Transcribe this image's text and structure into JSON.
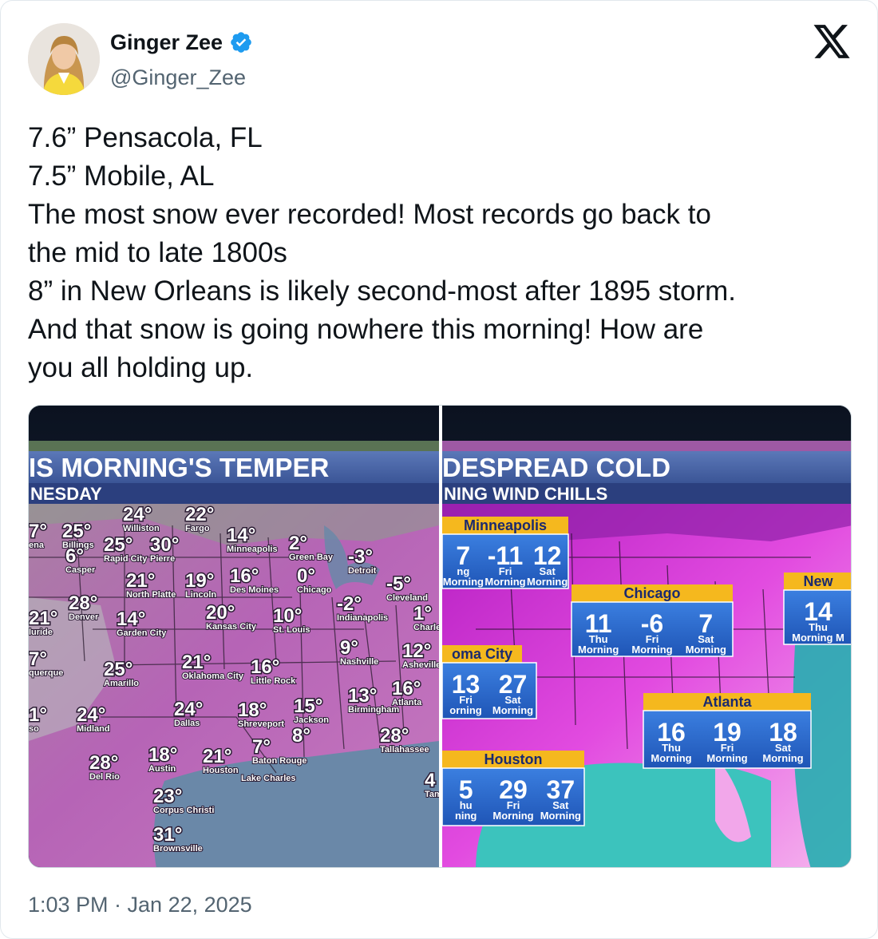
{
  "author": {
    "display_name": "Ginger Zee",
    "handle": "@Ginger_Zee",
    "verified_color": "#1d9bf0",
    "avatar_icon": "profile-photo"
  },
  "platform_icon": "x-logo-icon",
  "tweet": {
    "lines": [
      "7.6” Pensacola, FL",
      "7.5” Mobile, AL",
      "The most snow ever recorded! Most records go back to",
      "the mid to late 1800s",
      "8” in New Orleans is likely  second-most after 1895 storm.",
      "And that snow is going nowhere this morning! How are",
      "you all holding up."
    ],
    "timestamp": "1:03 PM · Jan 22, 2025"
  },
  "media": {
    "left_map": {
      "title": "IS MORNING'S TEMPER",
      "subtitle": "NESDAY",
      "readings": [
        {
          "t": "24°",
          "c": "Williston"
        },
        {
          "t": "22°",
          "c": "Fargo"
        },
        {
          "t": "7°",
          "c": "ena"
        },
        {
          "t": "25°",
          "c": "Billings"
        },
        {
          "t": "6°",
          "c": "Casper"
        },
        {
          "t": "25°",
          "c": "Rapid City"
        },
        {
          "t": "30°",
          "c": "Pierre"
        },
        {
          "t": "14°",
          "c": "Minneapolis"
        },
        {
          "t": "2°",
          "c": "Green Bay"
        },
        {
          "t": "-3°",
          "c": "Detroit"
        },
        {
          "t": "21°",
          "c": "North Platte"
        },
        {
          "t": "19°",
          "c": "Lincoln"
        },
        {
          "t": "16°",
          "c": "Des Moines"
        },
        {
          "t": "0°",
          "c": "Chicago"
        },
        {
          "t": "-5°",
          "c": "Cleveland"
        },
        {
          "t": "28°",
          "c": "Denver"
        },
        {
          "t": "-2°",
          "c": "Indianapolis"
        },
        {
          "t": "21°",
          "c": "luride"
        },
        {
          "t": "14°",
          "c": "Garden City"
        },
        {
          "t": "20°",
          "c": "Kansas City"
        },
        {
          "t": "10°",
          "c": "St. Louis"
        },
        {
          "t": "1°",
          "c": "Charleston"
        },
        {
          "t": "9°",
          "c": "Nashville"
        },
        {
          "t": "12°",
          "c": "Asheville"
        },
        {
          "t": "7°",
          "c": "querque"
        },
        {
          "t": "25°",
          "c": "Amarillo"
        },
        {
          "t": "21°",
          "c": "Oklahoma City"
        },
        {
          "t": "16°",
          "c": "Little Rock"
        },
        {
          "t": "13°",
          "c": "Birmingham"
        },
        {
          "t": "16°",
          "c": "Atlanta"
        },
        {
          "t": "24°",
          "c": "Midland"
        },
        {
          "t": "24°",
          "c": "Dallas"
        },
        {
          "t": "18°",
          "c": "Shreveport"
        },
        {
          "t": "15°",
          "c": "Jackson"
        },
        {
          "t": "28°",
          "c": "Tallahassee"
        },
        {
          "t": "8°",
          "c": ""
        },
        {
          "t": "7°",
          "c": "Baton Rouge"
        },
        {
          "t": "28°",
          "c": "Del Rio"
        },
        {
          "t": "18°",
          "c": "Austin"
        },
        {
          "t": "21°",
          "c": "Houston"
        },
        {
          "t": "",
          "c": "Lake Charles"
        },
        {
          "t": "4",
          "c": "Tam"
        },
        {
          "t": "23°",
          "c": "Corpus Christi"
        },
        {
          "t": "31°",
          "c": "Brownsville"
        },
        {
          "t": "1°",
          "c": "so"
        }
      ]
    },
    "right_map": {
      "title": "DESPREAD COLD",
      "subtitle": "NING WIND CHILLS",
      "boxes": [
        {
          "city": "Minneapolis",
          "values": [
            "7",
            "-11",
            "12"
          ],
          "labels": [
            "ng Morning",
            "Fri Morning",
            "Sat Morning"
          ]
        },
        {
          "city": "Chicago",
          "values": [
            "11",
            "-6",
            "7"
          ],
          "labels": [
            "Thu Morning",
            "Fri Morning",
            "Sat Morning"
          ]
        },
        {
          "city": "New",
          "values": [
            "14"
          ],
          "labels": [
            "Thu Morning M"
          ]
        },
        {
          "city": "oma City",
          "values": [
            "13",
            "27"
          ],
          "labels": [
            "Fri orning",
            "Sat Morning"
          ]
        },
        {
          "city": "Atlanta",
          "values": [
            "16",
            "19",
            "18"
          ],
          "labels": [
            "Thu Morning",
            "Fri Morning",
            "Sat Morning"
          ]
        },
        {
          "city": "Houston",
          "values": [
            "5",
            "29",
            "37"
          ],
          "labels": [
            "hu ning",
            "Fri Morning",
            "Sat Morning"
          ]
        }
      ]
    }
  }
}
